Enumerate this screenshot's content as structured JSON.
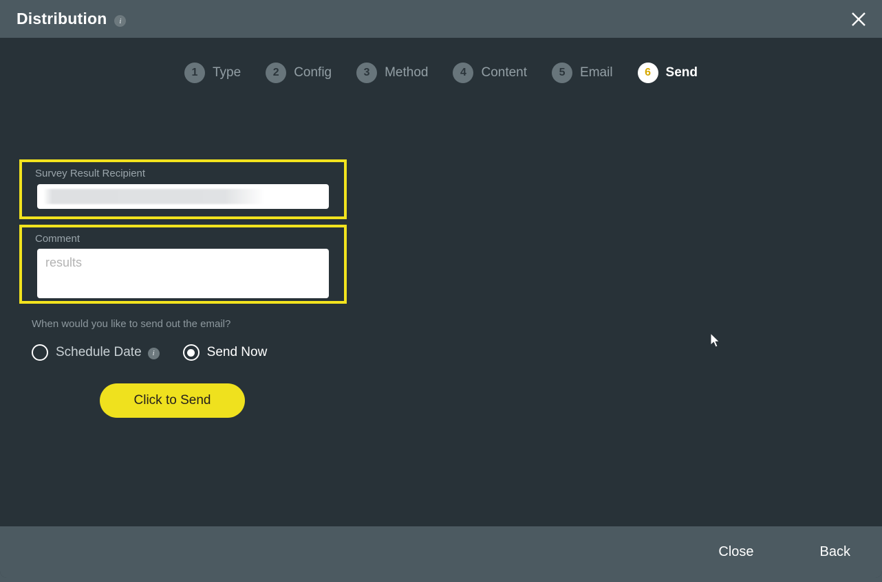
{
  "header": {
    "title": "Distribution",
    "info_icon": "info-icon",
    "close_icon": "close-icon"
  },
  "stepper": {
    "steps": [
      {
        "num": "1",
        "label": "Type",
        "active": false
      },
      {
        "num": "2",
        "label": "Config",
        "active": false
      },
      {
        "num": "3",
        "label": "Method",
        "active": false
      },
      {
        "num": "4",
        "label": "Content",
        "active": false
      },
      {
        "num": "5",
        "label": "Email",
        "active": false
      },
      {
        "num": "6",
        "label": "Send",
        "active": true
      }
    ]
  },
  "form": {
    "recipient": {
      "label": "Survey Result Recipient",
      "value": "",
      "placeholder": "",
      "redacted": true
    },
    "comment": {
      "label": "Comment",
      "value": "",
      "placeholder": "results"
    },
    "schedule_question": "When would you like to send out the email?",
    "radios": [
      {
        "label": "Schedule Date",
        "checked": false,
        "info_icon": "info-icon"
      },
      {
        "label": "Send Now",
        "checked": true
      }
    ],
    "send_button": "Click to Send"
  },
  "footer": {
    "close_label": "Close",
    "back_label": "Back"
  },
  "colors": {
    "header_bg": "#4c5a61",
    "body_bg": "#283238",
    "accent_yellow": "#efe11e",
    "highlight_border": "#f2e31e",
    "active_step_num": "#d6a800",
    "muted_text": "#8d989e"
  }
}
